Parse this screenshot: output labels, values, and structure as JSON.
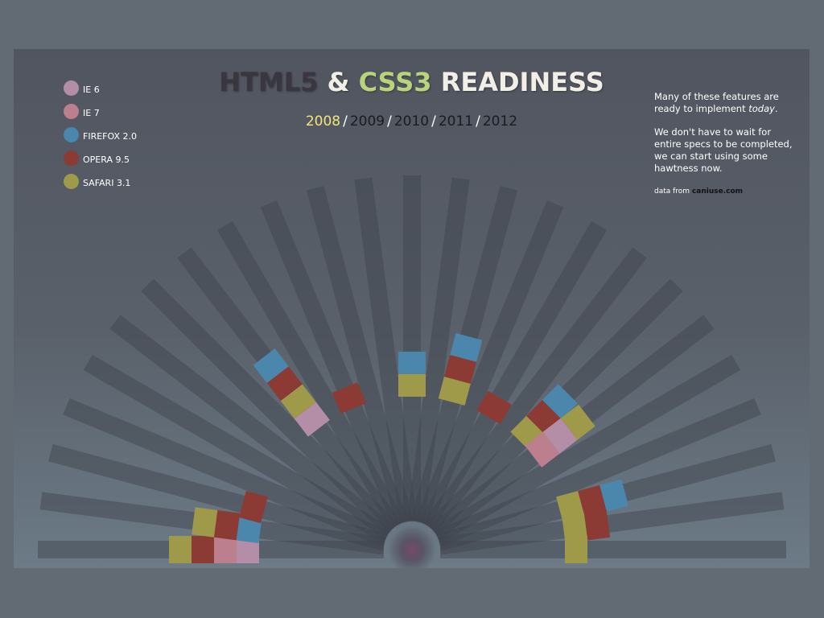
{
  "header": {
    "title_part1": "HTML5",
    "title_part2": "&",
    "title_part3": "CSS3",
    "title_part4": "READINESS"
  },
  "years": [
    {
      "label": "2008",
      "active": true
    },
    {
      "label": "2009",
      "active": false
    },
    {
      "label": "2010",
      "active": false
    },
    {
      "label": "2011",
      "active": false
    },
    {
      "label": "2012",
      "active": false
    }
  ],
  "year_separator": "/",
  "legend": [
    {
      "label": "IE 6",
      "color": "#b48da6"
    },
    {
      "label": "IE 7",
      "color": "#bc7f8d"
    },
    {
      "label": "FIREFOX 2.0",
      "color": "#4b86ad"
    },
    {
      "label": "OPERA 9.5",
      "color": "#8b3b33"
    },
    {
      "label": "SAFARI 3.1",
      "color": "#9e9a4a"
    }
  ],
  "note": {
    "para1_a": "Many of these features are ready to implement ",
    "para1_em": "today",
    "para1_b": ".",
    "para2": "We don't have to wait for entire specs to be completed, we can start using some hawtness now.",
    "source_prefix": "data from ",
    "source_name": "caniuse.com"
  },
  "chart_data": {
    "type": "radial-bar",
    "years": [
      "2008",
      "2009",
      "2010",
      "2011",
      "2012"
    ],
    "browsers": [
      "IE 6",
      "IE 7",
      "FIREFOX 2.0",
      "OPERA 9.5",
      "SAFARI 3.1"
    ],
    "features": [
      {
        "supported": [
          "IE 6",
          "IE 7",
          "OPERA 9.5",
          "SAFARI 3.1"
        ]
      },
      {
        "supported": [
          "FIREFOX 2.0",
          "OPERA 9.5",
          "SAFARI 3.1"
        ]
      },
      {
        "supported": [
          "OPERA 9.5"
        ]
      },
      {
        "supported": []
      },
      {
        "supported": []
      },
      {
        "supported": []
      },
      {
        "supported": []
      },
      {
        "supported": [
          "IE 6",
          "SAFARI 3.1",
          "OPERA 9.5",
          "FIREFOX 2.0"
        ]
      },
      {
        "supported": []
      },
      {
        "supported": [
          "OPERA 9.5"
        ]
      },
      {
        "supported": []
      },
      {
        "supported": []
      },
      {
        "supported": [
          "SAFARI 3.1",
          "FIREFOX 2.0"
        ]
      },
      {
        "supported": []
      },
      {
        "supported": [
          "SAFARI 3.1",
          "OPERA 9.5",
          "FIREFOX 2.0"
        ]
      },
      {
        "supported": []
      },
      {
        "supported": [
          "OPERA 9.5"
        ]
      },
      {
        "supported": []
      },
      {
        "supported": [
          "SAFARI 3.1",
          "OPERA 9.5",
          "FIREFOX 2.0"
        ]
      },
      {
        "supported": [
          "IE 7",
          "IE 6",
          "SAFARI 3.1"
        ]
      },
      {
        "supported": []
      },
      {
        "supported": []
      },
      {
        "supported": [
          "SAFARI 3.1",
          "OPERA 9.5",
          "FIREFOX 2.0"
        ]
      },
      {
        "supported": [
          "SAFARI 3.1",
          "OPERA 9.5"
        ]
      },
      {
        "supported": [
          "SAFARI 3.1"
        ]
      }
    ]
  }
}
